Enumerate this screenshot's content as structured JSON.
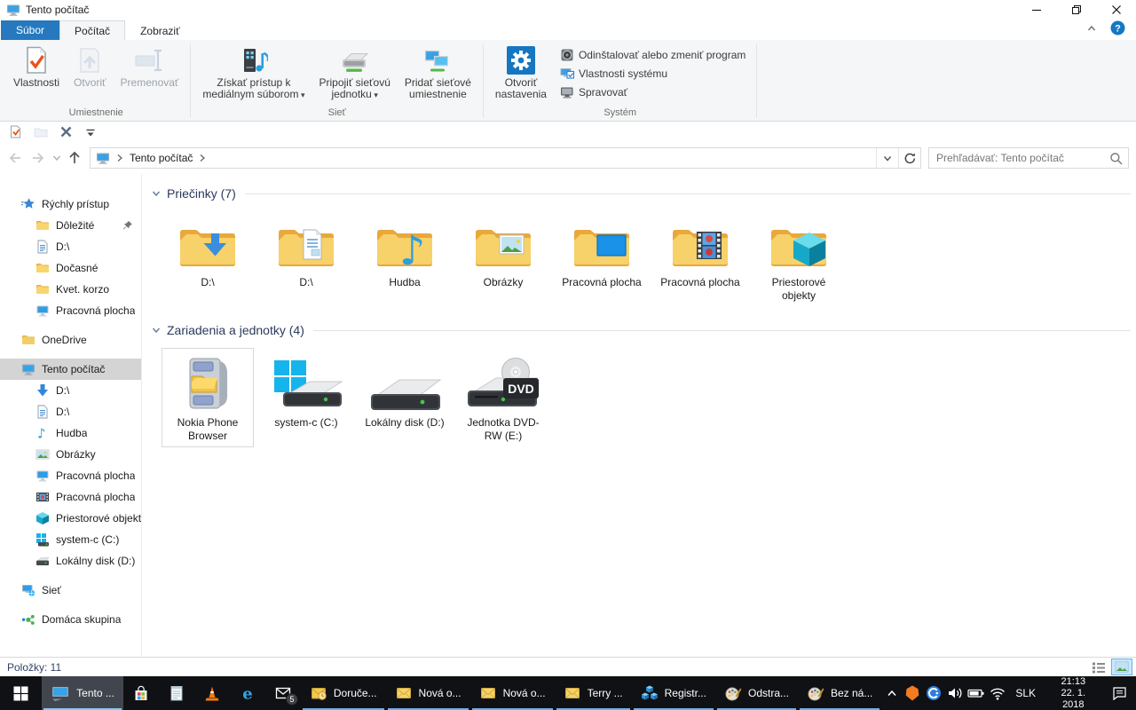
{
  "window": {
    "title": "Tento počítač"
  },
  "ribbon": {
    "file_tab": "Súbor",
    "tabs": [
      {
        "label": "Počítač",
        "active": true
      },
      {
        "label": "Zobraziť",
        "active": false
      }
    ],
    "groups": {
      "umiestnenie": {
        "label": "Umiestnenie",
        "buttons": [
          {
            "label": "Vlastnosti",
            "icon": "properties-check-icon",
            "disabled": false
          },
          {
            "label": "Otvoriť",
            "icon": "open-icon",
            "disabled": true
          },
          {
            "label": "Premenovať",
            "icon": "rename-icon",
            "disabled": true
          }
        ]
      },
      "siet": {
        "label": "Sieť",
        "buttons": [
          {
            "label": "Získať prístup k\nmediálnym súborom",
            "icon": "media-access-icon",
            "dropdown": true
          },
          {
            "label": "Pripojiť sieťovú\njednotku",
            "icon": "map-drive-icon",
            "dropdown": true
          },
          {
            "label": "Pridať sieťové\numiestnenie",
            "icon": "add-network-icon",
            "dropdown": false
          }
        ]
      },
      "system": {
        "label": "Systém",
        "big_button": {
          "label": "Otvoriť\nnastavenia",
          "icon": "settings-gear-icon"
        },
        "items": [
          {
            "label": "Odinštalovať alebo zmeniť program",
            "icon": "uninstall-icon"
          },
          {
            "label": "Vlastnosti systému",
            "icon": "system-properties-icon"
          },
          {
            "label": "Spravovať",
            "icon": "manage-icon"
          }
        ]
      }
    }
  },
  "quick_access_toolbar": [
    {
      "icon": "properties-small-icon",
      "disabled": false
    },
    {
      "icon": "new-folder-small-icon",
      "disabled": true
    },
    {
      "icon": "delete-x-icon",
      "disabled": false
    },
    {
      "icon": "customize-icon",
      "disabled": false
    }
  ],
  "address_bar": {
    "breadcrumb": "Tento počítač",
    "search_placeholder": "Prehľadávať: Tento počítač"
  },
  "sidebar": {
    "items": [
      {
        "label": "Rýchly prístup",
        "icon": "quick-access-star-icon",
        "level": 0
      },
      {
        "label": "Dôležité",
        "icon": "folder-icon",
        "level": 1,
        "pinned": true
      },
      {
        "label": "D:\\",
        "icon": "document-icon",
        "level": 1
      },
      {
        "label": "Dočasné",
        "icon": "folder-icon",
        "level": 1
      },
      {
        "label": "Kvet. korzo",
        "icon": "folder-icon",
        "level": 1
      },
      {
        "label": "Pracovná plocha",
        "icon": "desktop-icon",
        "level": 1
      },
      {
        "label": "OneDrive",
        "icon": "onedrive-icon",
        "level": 0,
        "gap_before": true
      },
      {
        "label": "Tento počítač",
        "icon": "computer-small-icon",
        "level": 0,
        "gap_before": true,
        "selected": true
      },
      {
        "label": "D:\\",
        "icon": "downloads-icon",
        "level": 1
      },
      {
        "label": "D:\\",
        "icon": "document-icon",
        "level": 1
      },
      {
        "label": "Hudba",
        "icon": "music-icon",
        "level": 1
      },
      {
        "label": "Obrázky",
        "icon": "pictures-icon",
        "level": 1
      },
      {
        "label": "Pracovná plocha",
        "icon": "desktop-icon",
        "level": 1
      },
      {
        "label": "Pracovná plocha",
        "icon": "videos-icon",
        "level": 1
      },
      {
        "label": "Priestorové objekty",
        "icon": "cube-icon",
        "level": 1
      },
      {
        "label": "system-c (C:)",
        "icon": "system-drive-icon",
        "level": 1
      },
      {
        "label": "Lokálny disk (D:)",
        "icon": "drive-icon",
        "level": 1
      },
      {
        "label": "Sieť",
        "icon": "network-icon",
        "level": 0,
        "gap_before": true
      },
      {
        "label": "Domáca skupina",
        "icon": "homegroup-icon",
        "level": 0,
        "gap_before": true
      }
    ]
  },
  "content": {
    "sections": [
      {
        "title": "Priečinky (7)",
        "tiles": [
          {
            "label": "D:\\",
            "icon": "folder-downloads-icon"
          },
          {
            "label": "D:\\",
            "icon": "folder-documents-icon"
          },
          {
            "label": "Hudba",
            "icon": "folder-music-icon"
          },
          {
            "label": "Obrázky",
            "icon": "folder-pictures-icon"
          },
          {
            "label": "Pracovná plocha",
            "icon": "folder-desktop-icon"
          },
          {
            "label": "Pracovná plocha",
            "icon": "folder-videos-icon"
          },
          {
            "label": "Priestorové objekty",
            "icon": "folder-3d-icon"
          }
        ]
      },
      {
        "title": "Zariadenia a jednotky (4)",
        "tiles": [
          {
            "label": "Nokia Phone Browser",
            "icon": "phone-browser-icon",
            "selected": true
          },
          {
            "label": "system-c (C:)",
            "icon": "system-drive-large-icon"
          },
          {
            "label": "Lokálny disk (D:)",
            "icon": "drive-large-icon"
          },
          {
            "label": "Jednotka DVD-RW (E:)",
            "icon": "dvd-drive-icon"
          }
        ]
      }
    ]
  },
  "status_bar": {
    "items_count": "Položky: 11"
  },
  "taskbar": {
    "buttons": [
      {
        "label": "Tento ...",
        "icon": "explorer-computer-icon",
        "active": true,
        "open": true
      },
      {
        "icon": "store-icon"
      },
      {
        "icon": "notepad-icon"
      },
      {
        "icon": "vlc-icon"
      },
      {
        "icon": "edge-icon"
      },
      {
        "icon": "mail-icon",
        "badge": "5"
      },
      {
        "label": "Doruče...",
        "icon": "outlook-icon",
        "open": true
      },
      {
        "label": "Nová o...",
        "icon": "envelope-icon",
        "open": true
      },
      {
        "label": "Nová o...",
        "icon": "envelope-icon",
        "open": true
      },
      {
        "label": "Terry ...",
        "icon": "envelope-icon",
        "open": true
      },
      {
        "label": "Registr...",
        "icon": "regedit-icon",
        "open": true
      },
      {
        "label": "Odstra...",
        "icon": "paint-icon",
        "open": true
      },
      {
        "label": "Bez ná...",
        "icon": "paint-icon",
        "open": true
      }
    ],
    "tray": {
      "icons": [
        "avast-icon",
        "secureline-icon",
        "volume-icon",
        "battery-icon",
        "wifi-icon"
      ],
      "language": "SLK",
      "time": "21:13",
      "date": "22. 1. 2018"
    }
  },
  "icon_glyphs": {
    "help": "?",
    "dvd_badge": "DVD",
    "music_note": "♪",
    "edge_e": "e",
    "dropdown_caret": "▾"
  }
}
